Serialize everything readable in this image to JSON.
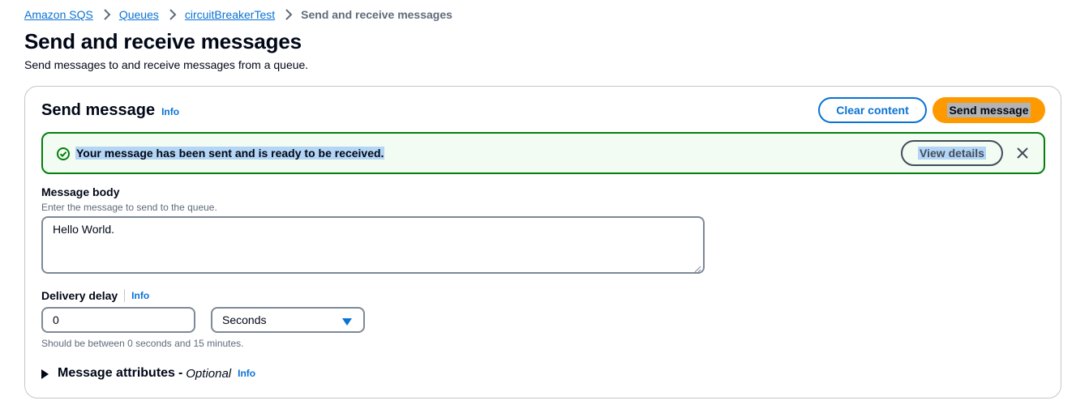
{
  "breadcrumb": {
    "items": [
      "Amazon SQS",
      "Queues",
      "circuitBreakerTest"
    ],
    "current": "Send and receive messages"
  },
  "page": {
    "title": "Send and receive messages",
    "description": "Send messages to and receive messages from a queue."
  },
  "send_card": {
    "title": "Send message",
    "info": "Info",
    "clear_button": "Clear content",
    "send_button": "Send message"
  },
  "flash": {
    "message": "Your message has been sent and is ready to be received.",
    "details_button": "View details",
    "icon": "check-circle-icon"
  },
  "message_body": {
    "label": "Message body",
    "description": "Enter the message to send to the queue.",
    "value": "Hello World."
  },
  "delivery_delay": {
    "label": "Delivery delay",
    "info": "Info",
    "value": "0",
    "unit": "Seconds",
    "constraint": "Should be between 0 seconds and 15 minutes."
  },
  "message_attributes": {
    "title": "Message attributes",
    "dash": "-",
    "optional": "Optional",
    "info": "Info"
  },
  "colors": {
    "link": "#0972d3",
    "primary": "#ff9900",
    "success": "#037f0c",
    "border": "#7d8998"
  }
}
